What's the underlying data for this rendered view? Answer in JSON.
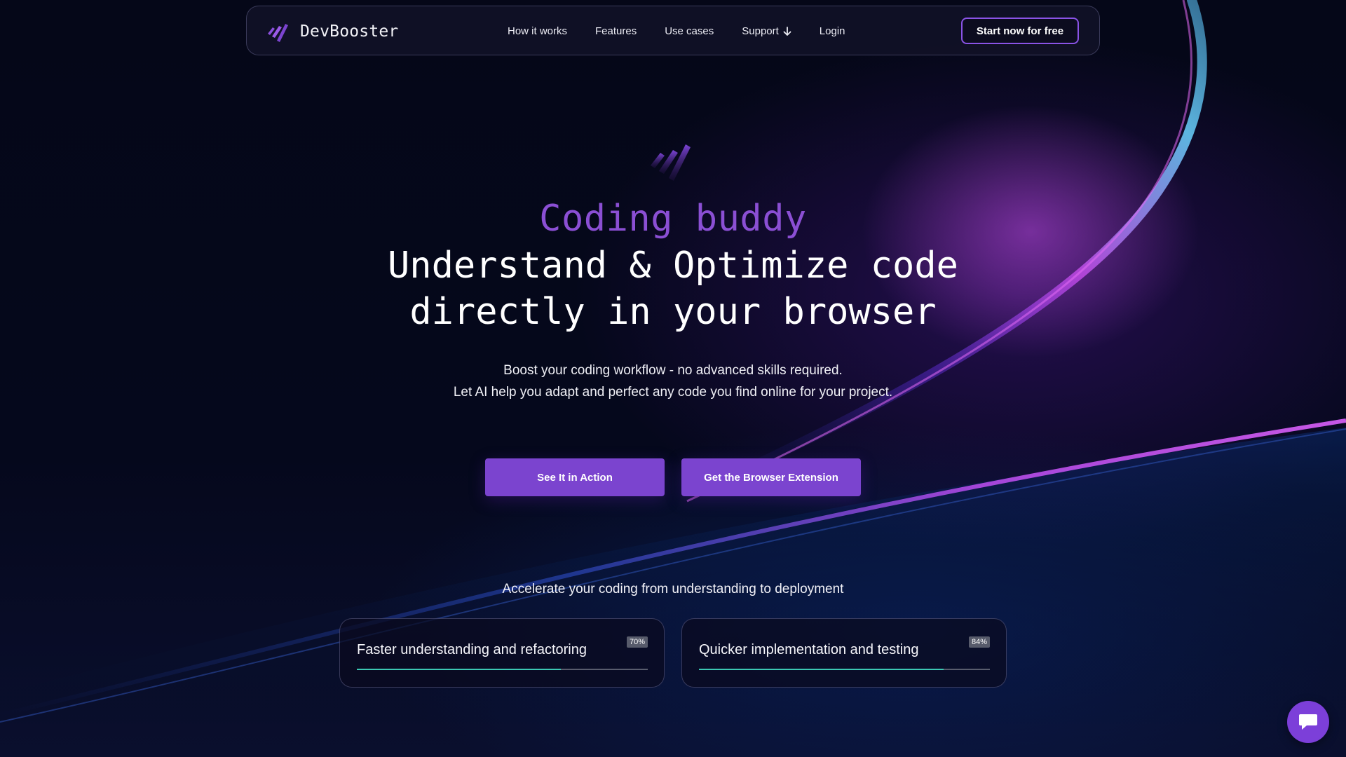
{
  "brand": {
    "name": "DevBooster",
    "icon": "devbooster-logo-icon"
  },
  "nav": {
    "links": [
      {
        "label": "How it works"
      },
      {
        "label": "Features"
      },
      {
        "label": "Use cases"
      },
      {
        "label": "Support",
        "icon": "arrow-down-icon"
      },
      {
        "label": "Login"
      }
    ],
    "cta_label": "Start now for free"
  },
  "hero": {
    "eyebrow": "Coding buddy",
    "title_line_1": "Understand & Optimize code",
    "title_line_2": "directly in your browser",
    "subtitle_line_1": "Boost your coding workflow - no advanced skills required.",
    "subtitle_line_2": "Let AI help you adapt and perfect any code you find online for your project.",
    "primary_button": "See It in Action",
    "secondary_button": "Get the Browser Extension"
  },
  "metrics": {
    "heading": "Accelerate your coding from understanding to deployment",
    "items": [
      {
        "label": "Faster understanding and refactoring",
        "percent_label": "70%",
        "value": 70
      },
      {
        "label": "Quicker implementation and testing",
        "percent_label": "84%",
        "value": 84
      }
    ]
  },
  "chat": {
    "icon": "chat-bubble-icon"
  },
  "colors": {
    "accent": "#7b44cf",
    "eyebrow": "#8b4fd4",
    "progress": "#3cc7b3",
    "background": "#040616"
  }
}
